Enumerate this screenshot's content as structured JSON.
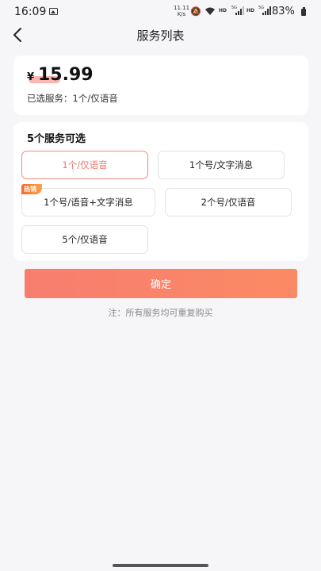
{
  "status_bar": {
    "time": "16:09",
    "speed_value": "11.11",
    "speed_unit": "K/s",
    "hd1": "HD",
    "net1": "5G",
    "hd2": "HD",
    "net2": "5G",
    "battery": "83%"
  },
  "header": {
    "title": "服务列表"
  },
  "price_card": {
    "currency": "¥",
    "price": "15.99",
    "selected_label": "已选服务：1个/仅语音"
  },
  "options": {
    "title": "5个服务可选",
    "items": [
      {
        "label": "1个/仅语音",
        "selected": true
      },
      {
        "label": "1个号/文字消息",
        "selected": false
      },
      {
        "label": "1个号/语音+文字消息",
        "selected": false,
        "badge": "热销"
      },
      {
        "label": "2个号/仅语音",
        "selected": false
      },
      {
        "label": "5个/仅语音",
        "selected": false
      }
    ]
  },
  "confirm_label": "确定",
  "note": "注：所有服务均可重复购买",
  "colors": {
    "accent": "#f87d6f",
    "selected_border": "#f0877f",
    "hot_badge": "#f56a2b"
  }
}
